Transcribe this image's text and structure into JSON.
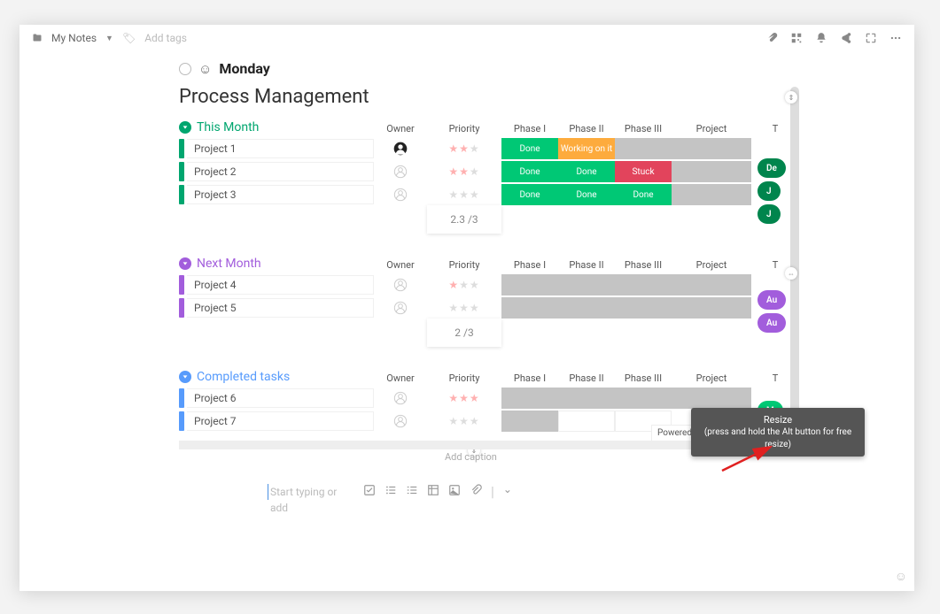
{
  "topbar": {
    "folder": "My Notes",
    "add_tags": "Add tags"
  },
  "embed": {
    "title": "Monday"
  },
  "board": {
    "title": "Process Management",
    "columns": [
      "Owner",
      "Priority",
      "Phase I",
      "Phase II",
      "Phase III",
      "Project",
      "T"
    ],
    "sections": [
      {
        "name": "This Month",
        "color": "#00a66f",
        "rows": [
          {
            "name": "Project 1",
            "owner": "filled",
            "stars": 2,
            "phases": [
              {
                "label": "Done",
                "bg": "#00c875"
              },
              {
                "label": "Working on it",
                "bg": "#fdab3d"
              },
              {
                "label": "",
                "bg": "#c4c4c4"
              }
            ],
            "project": {
              "bg": "#c4c4c4"
            },
            "pill": {
              "label": "De",
              "bg": "#00854d"
            }
          },
          {
            "name": "Project 2",
            "owner": "empty",
            "stars": 2,
            "phases": [
              {
                "label": "Done",
                "bg": "#00c875"
              },
              {
                "label": "Done",
                "bg": "#00c875"
              },
              {
                "label": "Stuck",
                "bg": "#e2445c"
              }
            ],
            "project": {
              "bg": "#c4c4c4"
            },
            "pill": {
              "label": "J",
              "bg": "#00854d"
            }
          },
          {
            "name": "Project 3",
            "owner": "empty",
            "stars_dim": 3,
            "phases": [
              {
                "label": "Done",
                "bg": "#00c875"
              },
              {
                "label": "Done",
                "bg": "#00c875"
              },
              {
                "label": "Done",
                "bg": "#00c875"
              }
            ],
            "project": {
              "bg": "#c4c4c4"
            },
            "pill": {
              "label": "J",
              "bg": "#00854d"
            }
          }
        ],
        "priority_summary": "2.3 /3"
      },
      {
        "name": "Next Month",
        "color": "#a25ddc",
        "rows": [
          {
            "name": "Project 4",
            "owner": "empty",
            "stars": 1,
            "phases": [
              {
                "label": "",
                "bg": "#c4c4c4"
              },
              {
                "label": "",
                "bg": "#c4c4c4"
              },
              {
                "label": "",
                "bg": "#c4c4c4"
              }
            ],
            "project": {
              "bg": "#c4c4c4"
            },
            "pill": {
              "label": "Au",
              "bg": "#a25ddc"
            }
          },
          {
            "name": "Project 5",
            "owner": "empty",
            "stars_dim": 3,
            "phases": [
              {
                "label": "",
                "bg": "#c4c4c4"
              },
              {
                "label": "",
                "bg": "#c4c4c4"
              },
              {
                "label": "",
                "bg": "#c4c4c4"
              }
            ],
            "project": {
              "bg": "#c4c4c4"
            },
            "pill": {
              "label": "Au",
              "bg": "#a25ddc"
            }
          }
        ],
        "priority_summary": "2 /3"
      },
      {
        "name": "Completed tasks",
        "color": "#579bfc",
        "rows": [
          {
            "name": "Project 6",
            "owner": "empty",
            "stars": 3,
            "phases": [
              {
                "label": "",
                "bg": "#c4c4c4"
              },
              {
                "label": "",
                "bg": "#c4c4c4"
              },
              {
                "label": "",
                "bg": "#c4c4c4"
              }
            ],
            "project": {
              "bg": "#c4c4c4"
            },
            "pill": {
              "label": "M",
              "bg": "#00c875"
            }
          },
          {
            "name": "Project 7",
            "owner": "empty",
            "stars": 0,
            "phases": [
              {
                "label": "",
                "bg": "#c4c4c4"
              },
              {
                "label": "",
                "bg": ""
              },
              {
                "label": "",
                "bg": ""
              }
            ],
            "project": {
              "bg": ""
            },
            "pill": null
          }
        ],
        "priority_summary": null
      }
    ]
  },
  "powered": "Powered by",
  "caption": "Add caption",
  "editor_placeholder": "Start typing or add",
  "tooltip": {
    "title": "Resize",
    "subtitle": "(press and hold the Alt button for free resize)"
  }
}
